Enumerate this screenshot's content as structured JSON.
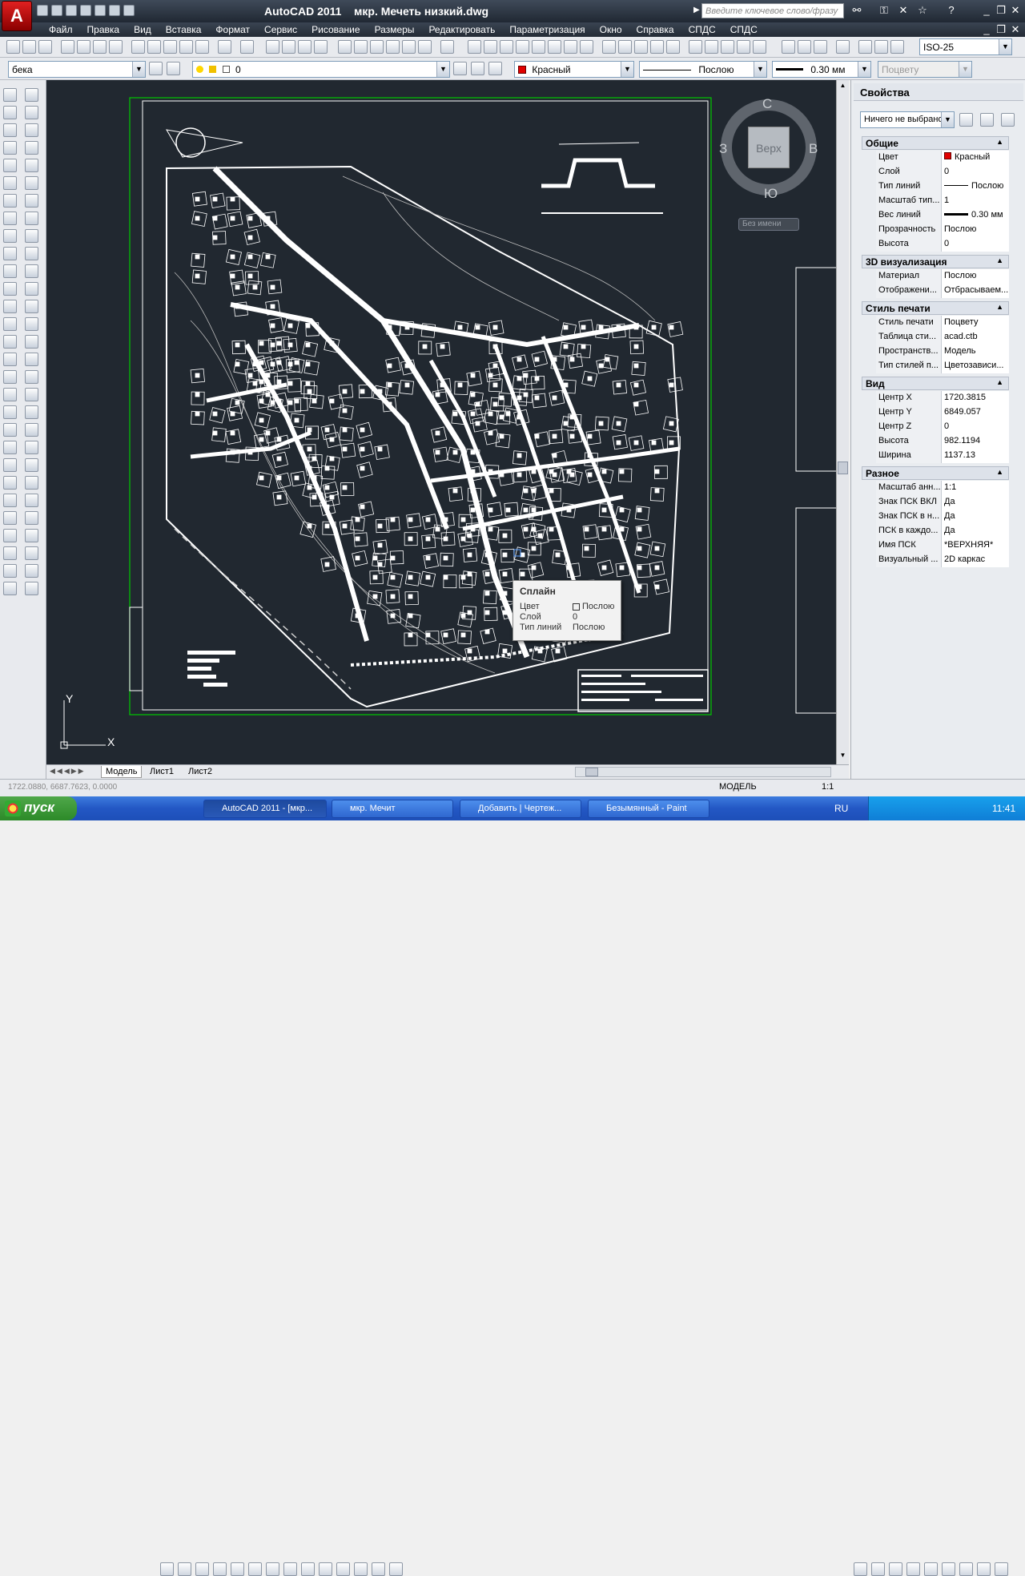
{
  "window": {
    "title": "AutoCAD 2011    мкр. Мечеть низкий.dwg",
    "search_placeholder": "Введите ключевое слово/фразу"
  },
  "menu": [
    "Файл",
    "Правка",
    "Вид",
    "Вставка",
    "Формат",
    "Сервис",
    "Рисование",
    "Размеры",
    "Редактировать",
    "Параметризация",
    "Окно",
    "Справка",
    "СПДС",
    "СПДС"
  ],
  "toolbar": {
    "dimstyle": "ISO-25",
    "workspace": "бека",
    "layer": "0",
    "color": "Красный",
    "linetype": "Послою",
    "lineweight": "0.30 мм",
    "plotstyle": "Поцвету"
  },
  "viewcube": {
    "north": "С",
    "south": "Ю",
    "west": "З",
    "east": "В",
    "face": "Верх",
    "ucs_menu": "Без имени"
  },
  "tooltip": {
    "title": "Сплайн",
    "rows": [
      {
        "key": "Цвет",
        "value": "Послою"
      },
      {
        "key": "Слой",
        "value": "0"
      },
      {
        "key": "Тип линий",
        "value": "Послою"
      }
    ]
  },
  "properties": {
    "title": "Свойства",
    "selection": "Ничего не выбрано",
    "sections": [
      {
        "name": "Общие",
        "rows": [
          {
            "key": "Цвет",
            "value": "Красный"
          },
          {
            "key": "Слой",
            "value": "0"
          },
          {
            "key": "Тип линий",
            "value": "Послою"
          },
          {
            "key": "Масштаб тип...",
            "value": "1"
          },
          {
            "key": "Вес линий",
            "value": "0.30 мм"
          },
          {
            "key": "Прозрачность",
            "value": "Послою"
          },
          {
            "key": "Высота",
            "value": "0"
          }
        ]
      },
      {
        "name": "3D визуализация",
        "rows": [
          {
            "key": "Материал",
            "value": "Послою"
          },
          {
            "key": "Отображени...",
            "value": "Отбрасываем..."
          }
        ]
      },
      {
        "name": "Стиль печати",
        "rows": [
          {
            "key": "Стиль печати",
            "value": "Поцвету"
          },
          {
            "key": "Таблица сти...",
            "value": "acad.ctb"
          },
          {
            "key": "Пространств...",
            "value": "Модель"
          },
          {
            "key": "Тип стилей п...",
            "value": "Цветозависи..."
          }
        ]
      },
      {
        "name": "Вид",
        "rows": [
          {
            "key": "Центр X",
            "value": "1720.3815"
          },
          {
            "key": "Центр Y",
            "value": "6849.057"
          },
          {
            "key": "Центр Z",
            "value": "0"
          },
          {
            "key": "Высота",
            "value": "982.1194"
          },
          {
            "key": "Ширина",
            "value": "1137.13"
          }
        ]
      },
      {
        "name": "Разное",
        "rows": [
          {
            "key": "Масштаб анн...",
            "value": "1:1"
          },
          {
            "key": "Знак ПСК ВКЛ",
            "value": "Да"
          },
          {
            "key": "Знак ПСК в н...",
            "value": "Да"
          },
          {
            "key": "ПСК в каждо...",
            "value": "Да"
          },
          {
            "key": "Имя ПСК",
            "value": "*ВЕРХНЯЯ*"
          },
          {
            "key": "Визуальный ...",
            "value": "2D каркас"
          }
        ]
      }
    ]
  },
  "tabs": [
    "Модель",
    "Лист1",
    "Лист2"
  ],
  "status": {
    "coords": "1722.0880, 6687.7623, 0.0000",
    "space": "МОДЕЛЬ",
    "scale": "1:1"
  },
  "ucs": {
    "x": "X",
    "y": "Y"
  },
  "taskbar": {
    "start": "пуск",
    "tasks": [
      "AutoCAD 2011 - [мкр...",
      "мкр. Мечит",
      "Добавить | Чертеж...",
      "Безымянный - Paint"
    ],
    "lang": "RU",
    "clock": "11:41"
  },
  "colors": {
    "canvas": "#212830",
    "red_swatch": "#e00000",
    "drawing_frame": "#00c800"
  }
}
